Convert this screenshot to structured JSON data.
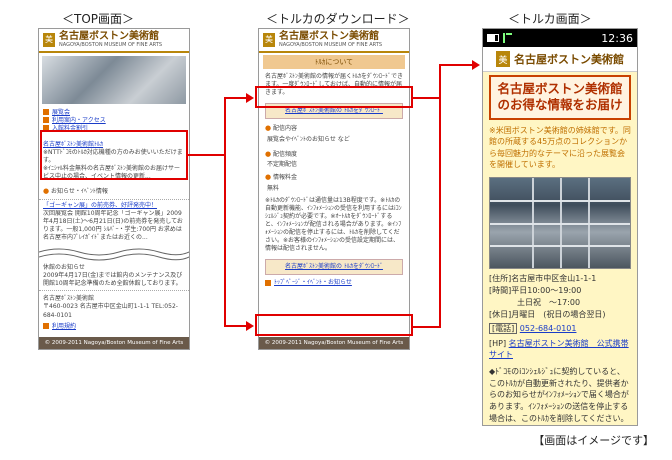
{
  "captions": {
    "top": "＜TOP画面＞",
    "download": "＜トルカのダウンロード＞",
    "torca": "＜トルカ画面＞"
  },
  "note": "【画面はイメージです】",
  "screen1": {
    "header_jp": "名古屋ボストン美術館",
    "header_en": "NAGOYA/BOSTON MUSEUM OF FINE ARTS",
    "menu": [
      "展覧会",
      "利用案内・アクセス",
      "入館料金割引"
    ],
    "torca_box_title": "名古屋ﾎﾞｽﾄﾝ美術館ﾄﾙｶ",
    "torca_box_text": "※NTTﾄﾞｺﾓのﾄﾙｶ対応機種の方のみお使いいただけます。",
    "torca_box_note": "※ｲﾆｼｬﾙ料金無料の名古屋ﾎﾞｽﾄﾝ美術館のお届けサービス中止の場合、イベント情報の更新...",
    "info_link": "お知らせ・ｲﾍﾞﾝﾄ情報",
    "exhibit_title": "「ゴーギャン展」の前売券、好評発売中！",
    "exhibit_text": "次回展覧会 開館10周年記念「ゴーギャン展」2009年4月18日(土)～6月21日(日)の前売券を発売しております。一般1,000円 ｼﾙﾊﾞｰ・学生:700円 お求めは名古屋市内ﾌﾟﾚｲｶﾞｲﾄﾞまたはお近くの...",
    "closed_title": "休館のお知らせ",
    "closed_text": "2009年4月17日(金)までは館内のメンテナンス及び開館10周年記念準備のため全館休館しております。",
    "address_title": "名古屋ﾎﾞｽﾄﾝ美術館",
    "address": "〒460-0023 名古屋市中区金山町1-1-1 TEL:052-684-0101",
    "access_link": "利用規約",
    "footer": "© 2009-2011 Nagoya/Boston Museum of Fine Arts"
  },
  "screen2": {
    "header_jp": "名古屋ボストン美術館",
    "header_en": "NAGOYA/BOSTON MUSEUM OF FINE ARTS",
    "section_title": "ﾄﾙｶについて",
    "intro": "名古屋ﾎﾞｽﾄﾝ美術館の情報が届くﾄﾙｶをﾀﾞｳﾝﾛｰﾄﾞできます。一度ﾀﾞｳﾝﾛｰﾄﾞしておけば、自動的に情報が届きます。",
    "dl_link": "名古屋ﾎﾞｽﾄﾝ美術館の ﾄﾙｶをﾀﾞｳﾝﾛｰﾄﾞ",
    "content_label": "配信内容",
    "content_text": "展覧会やｲﾍﾞﾝﾄのお知らせ など",
    "freq_label": "配信頻度",
    "freq_text": "不定期配信",
    "fee_label": "情報料金",
    "fee_text": "無料",
    "notes": "※ﾄﾙｶのﾀﾞｳﾝﾛｰﾄﾞは通信量は13B程度です。※ﾄﾙｶの自動更新機能、ｲﾝﾌｫﾒｰｼｮﾝの受信を利用するにはiｺﾝｼｪﾙｼﾞｭ契約が必要です。※ｵｰﾄﾙｶをﾀﾞｳﾝﾛｰﾄﾞすると、ｲﾝﾌｫﾒｰｼｮﾝが配信される場合があります。※ｲﾝﾌｫﾒｰｼｮﾝの配信を停止するには、ﾄﾙｶを削除してください。※お客様のｲﾝﾌｫﾒｰｼｮﾝの受信設定期間には、情報は配信されません。",
    "dl_link2": "名古屋ﾎﾞｽﾄﾝ美術館の ﾄﾙｶをﾀﾞｳﾝﾛｰﾄﾞ",
    "back_link": "ﾄｯﾌﾟﾍﾟｰｼﾞ・ｲﾍﾞﾝﾄ・お知らせ",
    "footer": "© 2009-2011 Nagoya/Boston Museum of Fine Arts"
  },
  "screen3": {
    "clock": "12:36",
    "app_title": "名古屋ボストン美術館",
    "banner_line1": "名古屋ボストン美術館",
    "banner_line2": "のお得な情報をお届け",
    "intro": "※米国ボストン美術館の姉妹館です。同館の所蔵する45万点のコレクションから毎回魅力的なテーマに沿った展覧会を開催しています。",
    "address": "[住所]名古屋市中区金山1-1-1",
    "hours1": "[時間]平日10:00～19:00",
    "hours2": "土日祝　～17:00",
    "closed": "[休日]月曜日　(祝日の場合翌日)",
    "tel_label": "[電話]",
    "tel": "052-684-0101",
    "hp_label": "[HP]",
    "hp_link": "名古屋ボストン美術館　公式携帯サイト",
    "footer_text": "◆ﾄﾞｺﾓのiｺﾝｼｪﾙｼﾞｭに契約していると、このﾄﾙｶが自動更新されたり、提供者からのお知らせがｲﾝﾌｫﾒｰｼｮﾝで届く場合があります。ｲﾝﾌｫﾒｰｼｮﾝの送信を停止する場合は、このﾄﾙｶを削除してください。"
  },
  "colors": {
    "arrow": "#e00000",
    "accent": "#b8860b",
    "app_bg": "#fff6c4"
  }
}
